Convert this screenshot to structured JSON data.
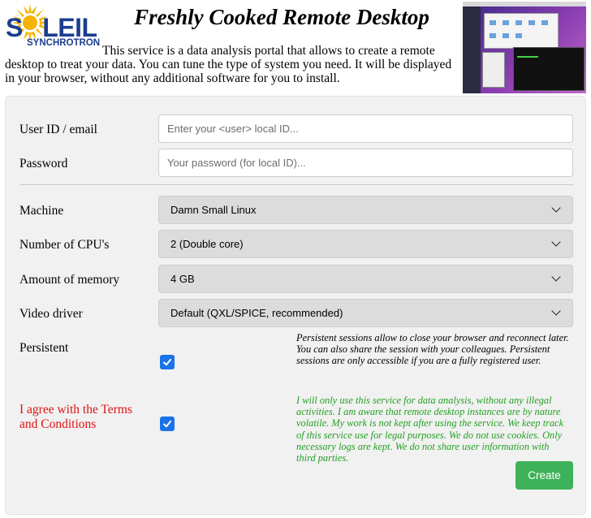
{
  "header": {
    "logo_word": "SOLEIL",
    "logo_sub": "SYNCHROTRON",
    "title": "Freshly Cooked Remote Desktop",
    "intro": "This service is a data analysis portal that allows to create a remote desktop to treat your data. You can tune the type of system you need. It will be displayed in your browser, without any additional software for you to install."
  },
  "form": {
    "user": {
      "label": "User ID / email",
      "placeholder": "Enter your <user> local ID...",
      "value": ""
    },
    "password": {
      "label": "Password",
      "placeholder": "Your password (for local ID)...",
      "value": ""
    },
    "machine": {
      "label": "Machine",
      "selected": "Damn Small Linux"
    },
    "cpu": {
      "label": "Number of CPU's",
      "selected": "2 (Double core)"
    },
    "memory": {
      "label": "Amount of memory",
      "selected": "4 GB"
    },
    "video": {
      "label": "Video driver",
      "selected": "Default (QXL/SPICE, recommended)"
    },
    "persistent": {
      "label": "Persistent",
      "checked": true,
      "note": "Persistent sessions allow to close your browser and reconnect later. You can also share the session with your colleagues. Persistent sessions are only accessible if you are a fully registered user."
    },
    "terms": {
      "label": "I agree with the Terms and Conditions",
      "checked": true,
      "note": "I will only use this service for data analysis, without any illegal activities. I am aware that remote desktop instances are by nature volatile. My work is not kept after using the service. We keep track of this service use for legal purposes. We do not use cookies. Only necessary logs are kept. We do not share user information with third parties."
    },
    "submit_label": "Create"
  },
  "colors": {
    "logo_blue": "#1c3e8f",
    "logo_sun": "#f5b400",
    "terms_red": "#e01212",
    "note_green": "#23a023",
    "checkbox_blue": "#1a73e8",
    "button_green": "#3eb25a"
  },
  "icons": {
    "logo": "soleil-sun-logo",
    "select_arrow": "chevron-down-icon",
    "checkbox": "checkmark-icon"
  }
}
